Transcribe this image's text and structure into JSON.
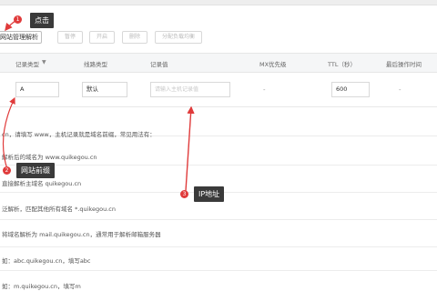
{
  "toolbar": {
    "buttons": [
      "网站管理解析",
      "暂停",
      "开启",
      "删除",
      "分配负载均衡"
    ]
  },
  "table": {
    "headers": [
      "记录类型",
      "线路类型",
      "记录值",
      "MX优先级",
      "TTL（秒）",
      "最后操作时间"
    ],
    "filter_icon": "filter-icon",
    "row": {
      "record_type": "A",
      "line_type": "默认",
      "record_value_placeholder": "请输入主机记录值",
      "mx_priority": "-",
      "ttl": "600",
      "last_op": "-"
    }
  },
  "hints": [
    "cn，请填写 www，主机记录就是域名前缀，常见用法有：",
    "解析后的域名为 www.quikegou.cn",
    "直接解析主域名 quikegou.cn",
    "泛解析，匹配其他所有域名 *.quikegou.cn",
    "将域名解析为 mail.quikegou.cn，通常用于解析邮箱服务器",
    "如：abc.quikegou.cn，填写abc",
    "如：m.quikegou.cn，填写m"
  ],
  "callouts": {
    "c1": {
      "num": "1",
      "text": "点击"
    },
    "c2": {
      "num": "2",
      "text": "网站前缀"
    },
    "c3": {
      "num": "3",
      "text": "IP地址"
    }
  },
  "colors": {
    "accent": "#e03b3b",
    "callout_bg": "#3a3a3a"
  }
}
